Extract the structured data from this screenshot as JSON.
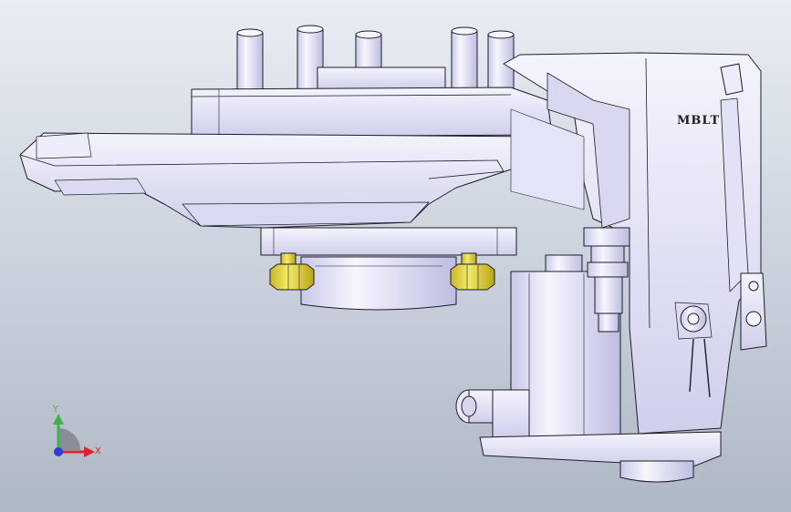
{
  "model": {
    "brand_marking": "MBLT",
    "body_color": "#e6e6f7",
    "edge_color": "#1c1c2a",
    "shadow_color": "#b6b6d6",
    "fastener_color": "#e8dc3a"
  },
  "triad": {
    "x_label": "X",
    "y_label": "Y",
    "x_color": "#d8262a",
    "y_color": "#3fb24a",
    "z_color": "#2a3fd8"
  }
}
